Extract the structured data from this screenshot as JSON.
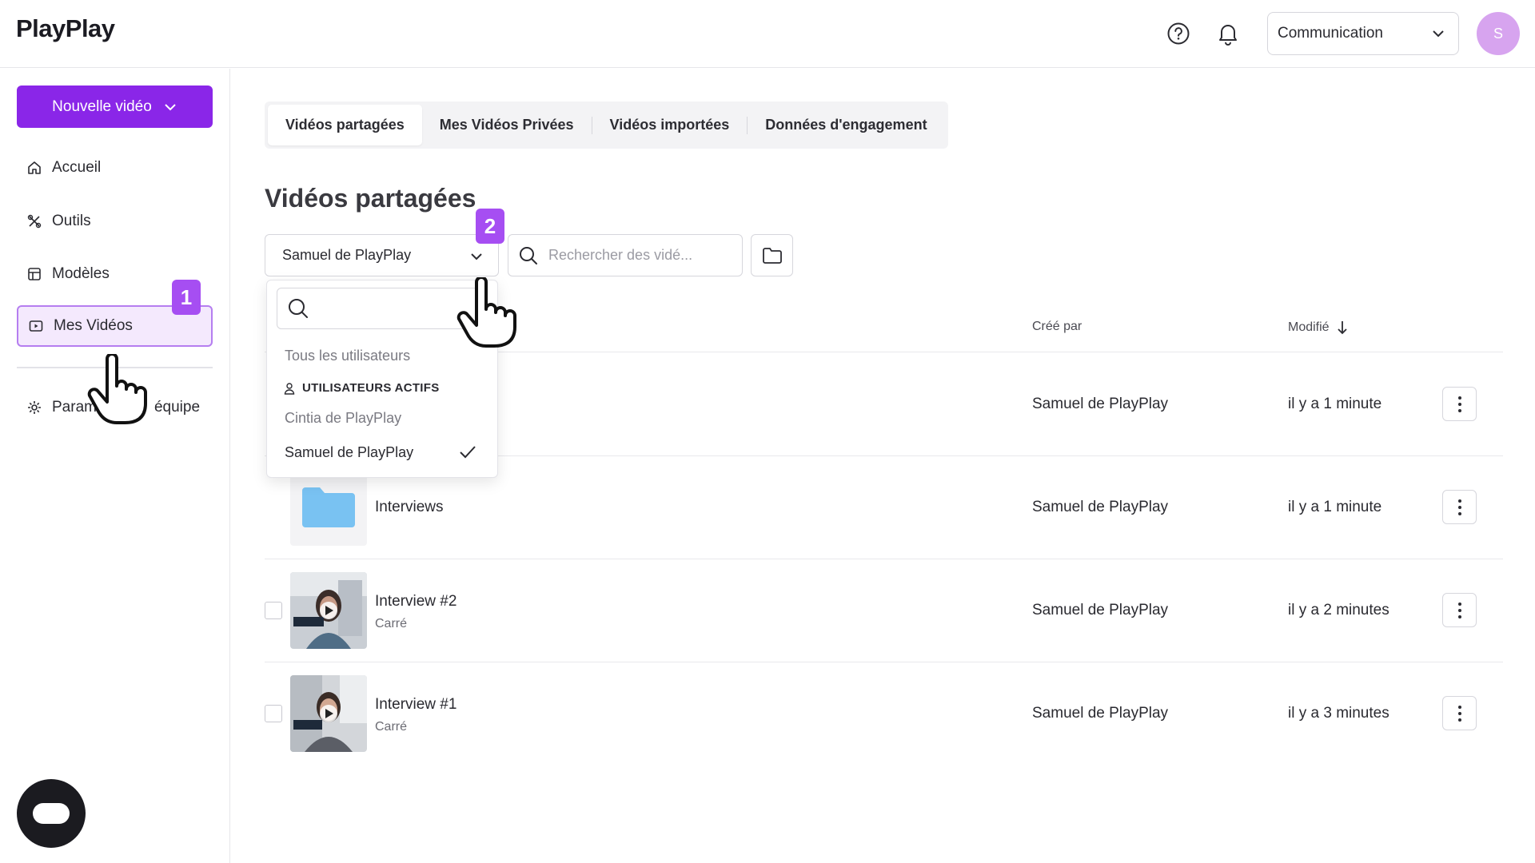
{
  "header": {
    "logo": "PlayPlay",
    "team_select": "Communication",
    "avatar_initial": "S"
  },
  "sidebar": {
    "new_video_label": "Nouvelle vidéo",
    "items": [
      {
        "label": "Accueil",
        "icon": "home-icon"
      },
      {
        "label": "Outils",
        "icon": "tools-icon"
      },
      {
        "label": "Modèles",
        "icon": "templates-icon"
      },
      {
        "label": "Mes Vidéos",
        "icon": "video-icon",
        "active": true
      },
      {
        "label_left": "Param",
        "label_right": "équipe",
        "icon": "gear-icon"
      }
    ]
  },
  "annotations": {
    "step1": "1",
    "step2": "2"
  },
  "tabs": [
    {
      "label": "Vidéos partagées",
      "active": true
    },
    {
      "label": "Mes Vidéos Privées"
    },
    {
      "label": "Vidéos importées"
    },
    {
      "label": "Données d'engagement"
    }
  ],
  "page_title": "Vidéos partagées",
  "filters": {
    "user_filter_value": "Samuel de PlayPlay",
    "search_placeholder": "Rechercher des vidé..."
  },
  "dropdown": {
    "search_value": "",
    "all_users": "Tous les utilisateurs",
    "group_label": "UTILISATEURS ACTIFS",
    "users": [
      {
        "label": "Cintia de PlayPlay",
        "selected": false
      },
      {
        "label": "Samuel de PlayPlay",
        "selected": true
      }
    ]
  },
  "table": {
    "col_created_by": "Créé par",
    "col_modified": "Modifié",
    "rows": [
      {
        "name": "",
        "subtitle": "",
        "created_by": "Samuel de PlayPlay",
        "modified": "il y a 1 minute",
        "kind": "hidden"
      },
      {
        "name": "Interviews",
        "subtitle": "",
        "created_by": "Samuel de PlayPlay",
        "modified": "il y a 1 minute",
        "kind": "folder"
      },
      {
        "name": "Interview #2",
        "subtitle": "Carré",
        "created_by": "Samuel de PlayPlay",
        "modified": "il y a 2 minutes",
        "kind": "video"
      },
      {
        "name": "Interview #1",
        "subtitle": "Carré",
        "created_by": "Samuel de PlayPlay",
        "modified": "il y a 3 minutes",
        "kind": "video"
      }
    ]
  },
  "colors": {
    "accent": "#8a26e8",
    "badge": "#a64ef2",
    "avatar": "#d7a4ef",
    "folder": "#79c2f2"
  }
}
